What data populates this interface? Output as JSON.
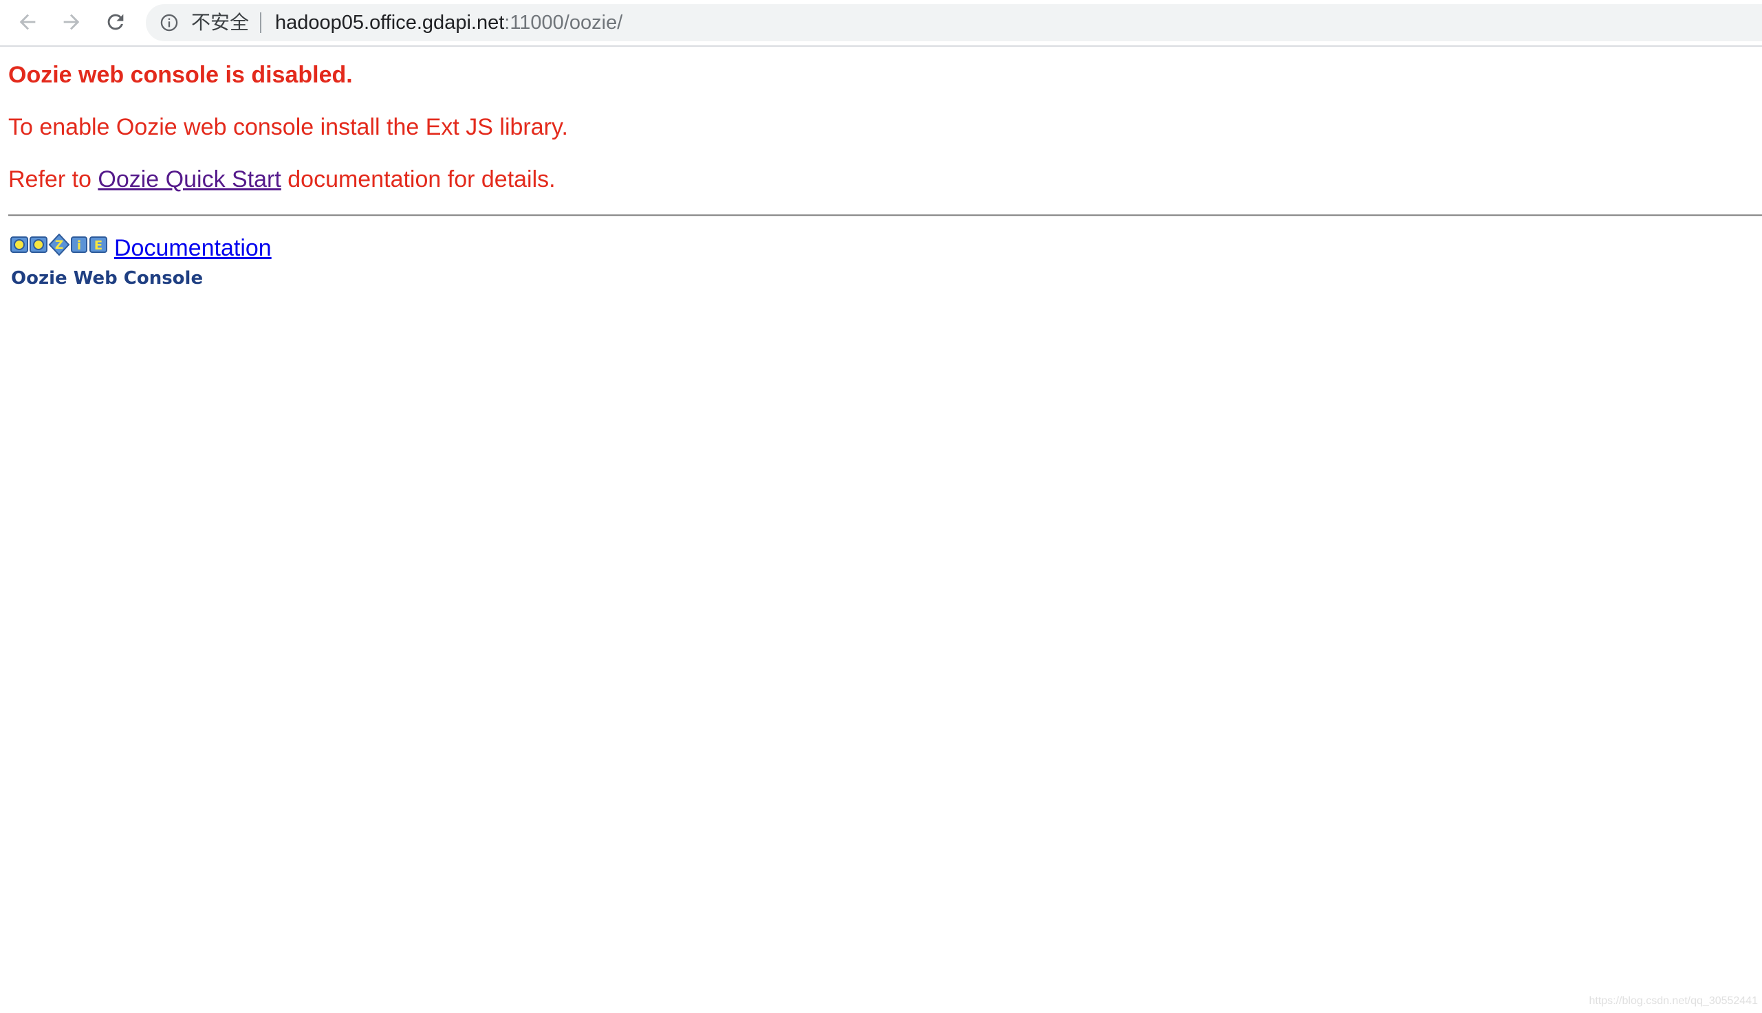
{
  "browser": {
    "security_label": "不安全",
    "url_host": "hadoop05.office.gdapi.net",
    "url_path": ":11000/oozie/"
  },
  "page": {
    "title": "Oozie web console is disabled.",
    "enable_text": "To enable Oozie web console install the Ext JS library.",
    "refer_prefix": "Refer to ",
    "quick_start_link": "Oozie Quick Start",
    "refer_suffix": " documentation for details.",
    "logo_text": "OOZIE",
    "documentation_link": "Documentation",
    "console_label": "Oozie Web Console"
  },
  "watermark": "https://blog.csdn.net/qq_30552441",
  "colors": {
    "error_red": "#e32a1c",
    "visited_link": "#551a8b",
    "link_blue": "#0000ee",
    "console_label": "#1f3f82"
  }
}
